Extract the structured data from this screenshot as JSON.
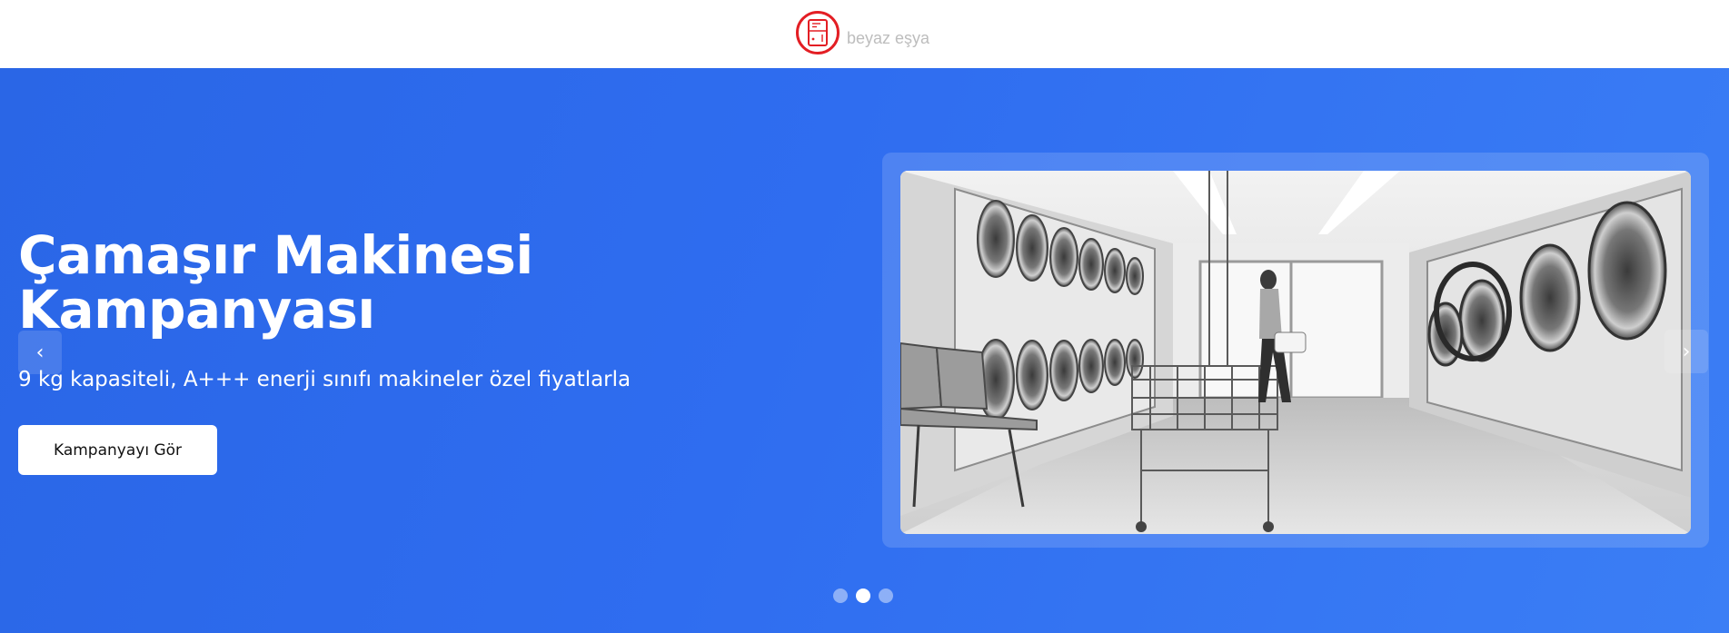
{
  "header": {
    "brand_name": "beyaz eşya",
    "logo_icon": "fridge-icon",
    "logo_color": "#e31e24"
  },
  "hero": {
    "title": "Çamaşır Makinesi Kampanyası",
    "subtitle": "9 kg kapasiteli, A+++ enerji sınıfı makineler özel fiyatlarla",
    "cta_label": "Kampanyayı Gör",
    "background_color": "#2f6df0",
    "image_subject": "laundromat with rows of washing machines and laundry carts",
    "prev_icon": "chevron-left-icon",
    "prev_glyph": "‹",
    "next_icon": "chevron-right-icon",
    "next_glyph": "›"
  },
  "carousel": {
    "slide_count": 3,
    "active_index": 1
  }
}
